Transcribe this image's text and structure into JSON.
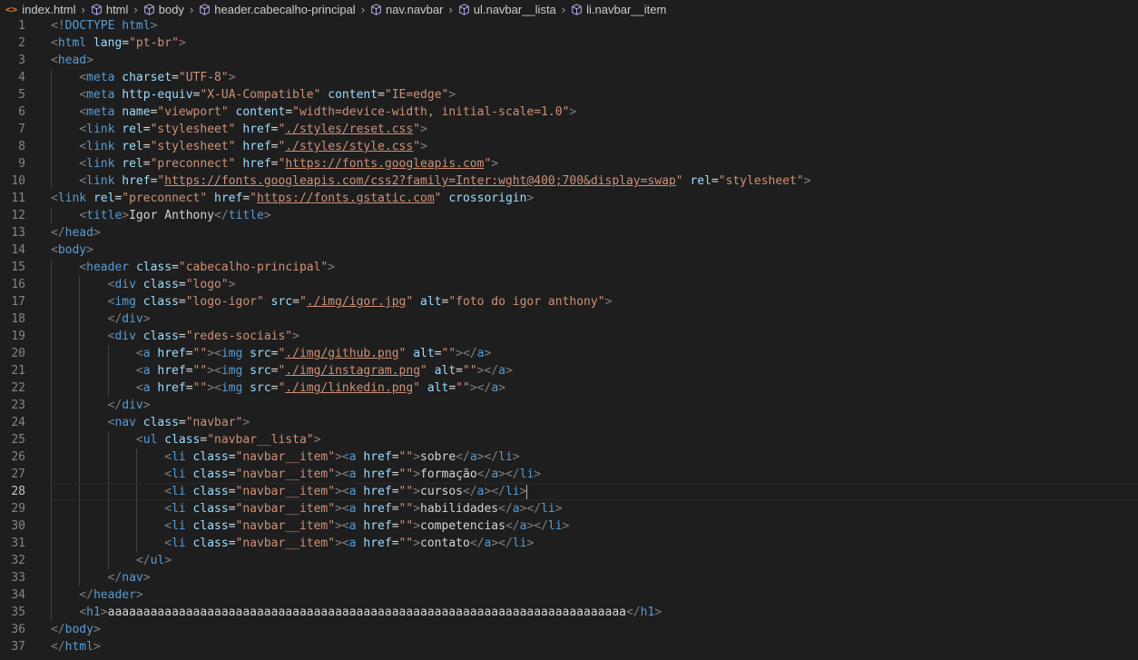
{
  "breadcrumb": {
    "file": "index.html",
    "items": [
      "html",
      "body",
      "header.cabecalho-principal",
      "nav.navbar",
      "ul.navbar__lista",
      "li.navbar__item"
    ]
  },
  "editor": {
    "current_line": 28,
    "lines": [
      "<!DOCTYPE html>",
      "<html lang=\"pt-br\">",
      "<head>",
      "    <meta charset=\"UTF-8\">",
      "    <meta http-equiv=\"X-UA-Compatible\" content=\"IE=edge\">",
      "    <meta name=\"viewport\" content=\"width=device-width, initial-scale=1.0\">",
      "    <link rel=\"stylesheet\" href=\"./styles/reset.css\">",
      "    <link rel=\"stylesheet\" href=\"./styles/style.css\">",
      "    <link rel=\"preconnect\" href=\"https://fonts.googleapis.com\">",
      "    <link href=\"https://fonts.googleapis.com/css2?family=Inter:wght@400;700&display=swap\" rel=\"stylesheet\">",
      "<link rel=\"preconnect\" href=\"https://fonts.gstatic.com\" crossorigin>",
      "    <title>Igor Anthony</title>",
      "</head>",
      "<body>",
      "    <header class=\"cabecalho-principal\">",
      "        <div class=\"logo\">",
      "        <img class=\"logo-igor\" src=\"./img/igor.jpg\" alt=\"foto do igor anthony\">",
      "        </div>",
      "        <div class=\"redes-sociais\">",
      "            <a href=\"\"><img src=\"./img/github.png\" alt=\"\"></a>",
      "            <a href=\"\"><img src=\"./img/instagram.png\" alt=\"\"></a>",
      "            <a href=\"\"><img src=\"./img/linkedin.png\" alt=\"\"></a>",
      "        </div>",
      "        <nav class=\"navbar\">",
      "            <ul class=\"navbar__lista\">",
      "                <li class=\"navbar__item\"><a href=\"\">sobre</a></li>",
      "                <li class=\"navbar__item\"><a href=\"\">formação</a></li>",
      "                <li class=\"navbar__item\"><a href=\"\">cursos</a></li>",
      "                <li class=\"navbar__item\"><a href=\"\">habilidades</a></li>",
      "                <li class=\"navbar__item\"><a href=\"\">competencias</a></li>",
      "                <li class=\"navbar__item\"><a href=\"\">contato</a></li>",
      "            </ul>",
      "        </nav>",
      "    </header>",
      "    <h1>aaaaaaaaaaaaaaaaaaaaaaaaaaaaaaaaaaaaaaaaaaaaaaaaaaaaaaaaaaaaaaaaaaaaaaaaa</h1>",
      "</body>",
      "</html>"
    ]
  },
  "colors": {
    "background": "#1e1e1e",
    "tag": "#569cd6",
    "attribute": "#9cdcfe",
    "string": "#ce9178",
    "punctuation": "#808080",
    "text": "#d4d4d4"
  }
}
